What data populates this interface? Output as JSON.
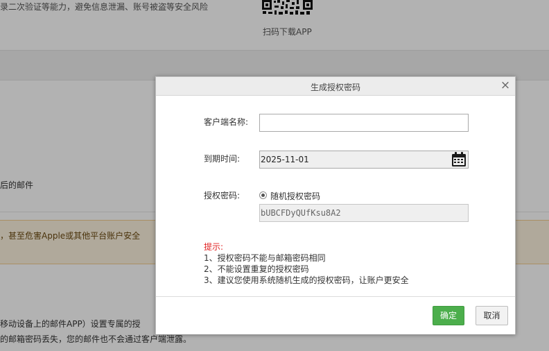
{
  "background": {
    "two_step_desc": "录二次验证等能力，避免信息泄漏、账号被盗等安全风险",
    "qr_caption": "扫码下载APP",
    "mail_text": "后的邮件",
    "warning_text": "，甚至危害Apple或其他平台账户安全",
    "line1": "移动设备上的邮件APP）设置专属的授",
    "line2": "的邮箱密码丢失，您的邮件也不会通过客户端泄露。"
  },
  "dialog": {
    "title": "生成授权密码",
    "close_symbol": "×",
    "client_name_label": "客户端名称:",
    "client_name_value": "",
    "client_name_placeholder": "",
    "expiry_label": "到期时间:",
    "expiry_value": "2025-11-01",
    "password_label": "授权密码:",
    "random_option_label": "随机授权密码",
    "random_password": "bUBCFDyQUfKsu8A2",
    "tips_title": "提示:",
    "tips": [
      "1、授权密码不能与邮箱密码相同",
      "2、不能设置重复的授权密码",
      "3、建议您使用系统随机生成的授权密码，让账户更安全"
    ],
    "confirm_label": "确定",
    "cancel_label": "取消"
  },
  "colors": {
    "confirm_button": "#4cae4c",
    "tips_title": "#e02020",
    "overlay": "rgba(0,0,0,0.30)"
  }
}
